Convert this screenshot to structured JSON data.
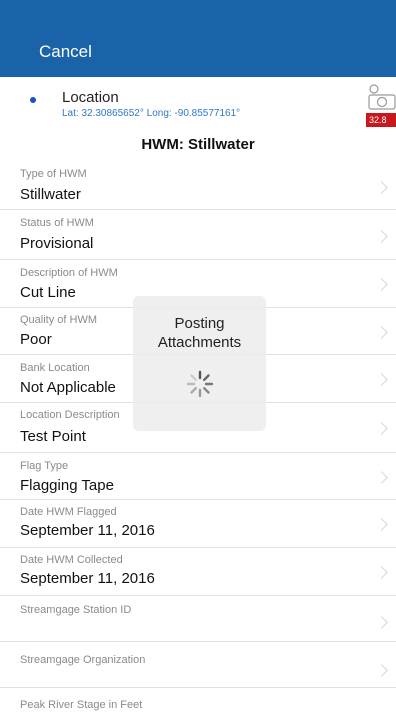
{
  "navbar": {
    "cancel_label": "Cancel"
  },
  "location": {
    "title": "Location",
    "coords": "Lat: 32.30865652° Long: -90.85577161°",
    "camera_badge": "32.8"
  },
  "section_title": "HWM: Stillwater",
  "fields": [
    {
      "label": "Type of HWM",
      "value": "Stillwater"
    },
    {
      "label": "Status of HWM",
      "value": "Provisional"
    },
    {
      "label": "Description of HWM",
      "value": "Cut Line"
    },
    {
      "label": "Quality of HWM",
      "value": "Poor"
    },
    {
      "label": "Bank Location",
      "value": "Not Applicable"
    },
    {
      "label": "Location Description",
      "value": "Test Point"
    },
    {
      "label": "Flag Type",
      "value": "Flagging Tape"
    },
    {
      "label": "Date HWM Flagged",
      "value": "September 11, 2016"
    },
    {
      "label": "Date HWM Collected",
      "value": "September 11, 2016"
    },
    {
      "label": "Streamgage Station ID",
      "value": ""
    },
    {
      "label": "Streamgage Organization",
      "value": ""
    },
    {
      "label": "Peak River Stage in Feet",
      "value": ""
    }
  ],
  "overlay": {
    "line1": "Posting",
    "line2": "Attachments"
  },
  "colors": {
    "navbar": "#1b63a8",
    "coords": "#2f78c8",
    "badge": "#c8181e"
  }
}
